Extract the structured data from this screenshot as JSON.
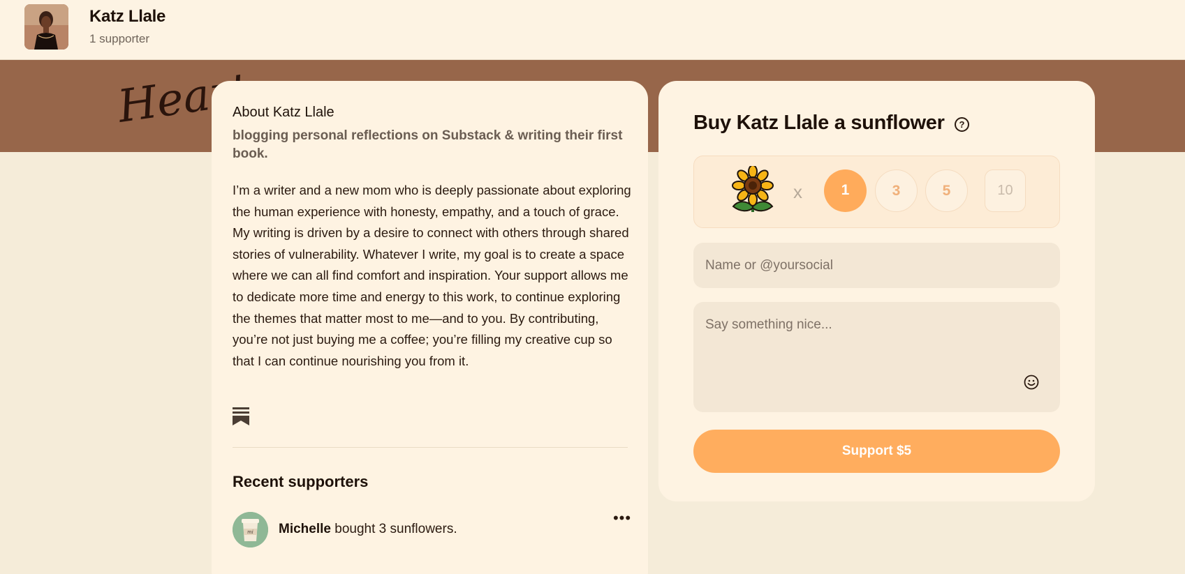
{
  "header": {
    "creator_name": "Katz Llale",
    "supporter_count": "1 supporter"
  },
  "banner": {
    "script_text": "Heart"
  },
  "about": {
    "title": "About Katz Llale",
    "tagline": "blogging personal reflections on Substack & writing their first book.",
    "body": "I’m a writer and a new mom who is deeply passionate about exploring the human experience with honesty, empathy, and a touch of grace. My writing is driven by a desire to connect with others through shared stories of vulnerability. Whatever I write, my goal is to create a space where we can all find comfort and inspiration. Your support allows me to dedicate more time and energy to this work, to continue exploring the themes that matter most to me—and to you. By contributing, you’re not just buying me a coffee; you’re filling my creative cup so that I can continue nourishing you from it."
  },
  "recent": {
    "title": "Recent supporters",
    "items": [
      {
        "name": "Michelle",
        "action": " bought 3 sunflowers.",
        "avatar_text": "mi"
      }
    ]
  },
  "support": {
    "title": "Buy Katz Llale a sunflower",
    "help": "?",
    "times": "x",
    "quantities": [
      "1",
      "3",
      "5",
      "10"
    ],
    "selected_quantity": "1",
    "name_placeholder": "Name or @yoursocial",
    "message_placeholder": "Say something nice...",
    "button_label": "Support $5"
  },
  "colors": {
    "accent": "#ffad5e",
    "banner": "#97664a",
    "card": "#fef3e2",
    "page": "#f5ecd9"
  }
}
